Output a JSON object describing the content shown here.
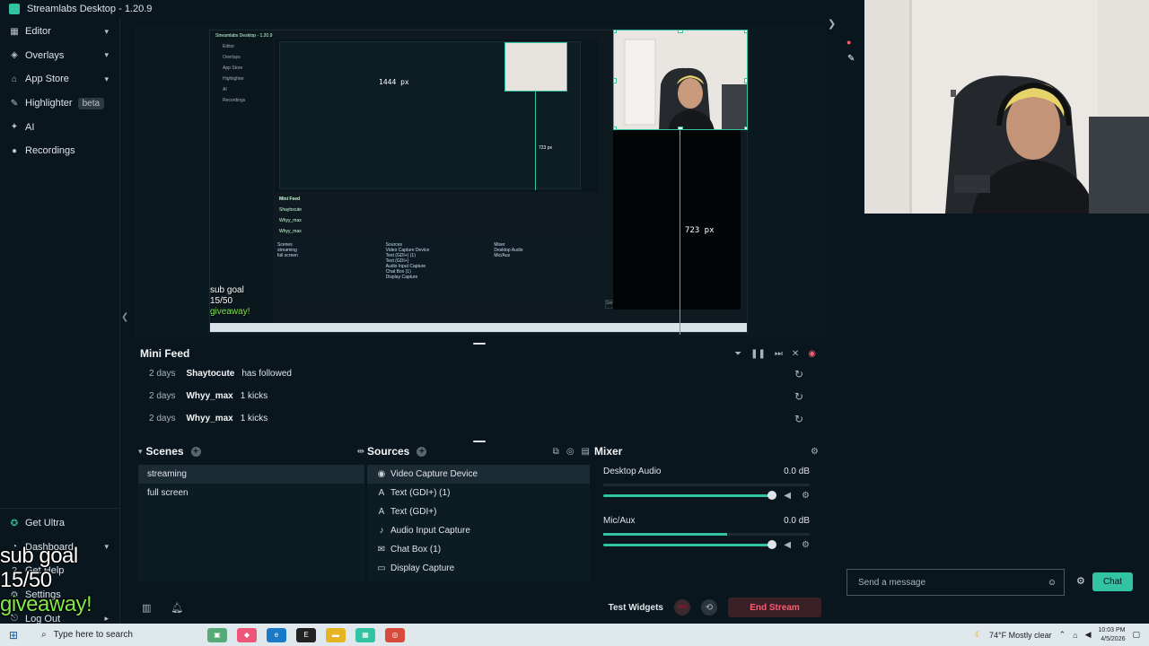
{
  "window": {
    "title": "Streamlabs Desktop - 1.20.9"
  },
  "sidebar": {
    "items": [
      {
        "label": "Editor",
        "icon": "editor-icon",
        "chevron": true
      },
      {
        "label": "Overlays",
        "icon": "overlays-icon",
        "chevron": true
      },
      {
        "label": "App Store",
        "icon": "app-store-icon",
        "chevron": true
      },
      {
        "label": "Highlighter",
        "icon": "highlighter-icon",
        "badge": "beta"
      },
      {
        "label": "AI",
        "icon": "ai-icon"
      },
      {
        "label": "Recordings",
        "icon": "recordings-icon"
      }
    ],
    "bottom_items": [
      {
        "label": "Get Ultra",
        "icon": "ultra-icon"
      },
      {
        "label": "Dashboard",
        "icon": "dashboard-icon",
        "chevron": true
      },
      {
        "label": "Get Help",
        "icon": "help-icon"
      },
      {
        "label": "Settings",
        "icon": "settings-icon"
      },
      {
        "label": "Log Out",
        "icon": "logout-icon"
      }
    ]
  },
  "preview": {
    "dimension_label": "723 px",
    "nested_dimension_label": "1444 px",
    "nested_title": "Streamlabs Desktop - 1.20.9",
    "nested_small_label": "723 px"
  },
  "mini_feed": {
    "title": "Mini Feed",
    "rows": [
      {
        "time": "2 days",
        "name": "Shaytocute",
        "message": "has followed"
      },
      {
        "time": "2 days",
        "name": "Whyy_max",
        "message": "1 kicks"
      },
      {
        "time": "2 days",
        "name": "Whyy_max",
        "message": "1 kicks"
      }
    ]
  },
  "scenes": {
    "title": "Scenes",
    "items": [
      "streaming",
      "full screen"
    ],
    "selected": "streaming"
  },
  "sources": {
    "title": "Sources",
    "items": [
      {
        "label": "Video Capture Device",
        "icon": "camera-icon"
      },
      {
        "label": "Text (GDI+) (1)",
        "icon": "text-icon"
      },
      {
        "label": "Text (GDI+)",
        "icon": "text-icon"
      },
      {
        "label": "Audio Input Capture",
        "icon": "microphone-icon"
      },
      {
        "label": "Chat Box (1)",
        "icon": "chat-icon"
      },
      {
        "label": "Display Capture",
        "icon": "monitor-icon"
      }
    ],
    "selected": "Video Capture Device"
  },
  "mixer": {
    "title": "Mixer",
    "channels": [
      {
        "name": "Desktop Audio",
        "level": "0.0 dB",
        "meter": 0.0,
        "volume": 1.0
      },
      {
        "name": "Mic/Aux",
        "level": "0.0 dB",
        "meter": 0.6,
        "volume": 1.0
      }
    ]
  },
  "footer": {
    "test_widgets": "Test Widgets",
    "rec_label": "REC",
    "end_stream": "End Stream"
  },
  "chat": {
    "placeholder": "Send a message",
    "send_label": "Chat"
  },
  "overlay": {
    "line1": "sub goal",
    "line2": "15/50",
    "line3": "giveaway!"
  },
  "taskbar": {
    "search_placeholder": "Type here to search",
    "weather": "74°F  Mostly clear",
    "time": "10:03 PM",
    "date": "4/5/2026"
  },
  "colors": {
    "accent": "#31c3a2",
    "background": "#09161d",
    "end_stream": "#f85c70",
    "giveaway_green": "#7fe84a"
  }
}
